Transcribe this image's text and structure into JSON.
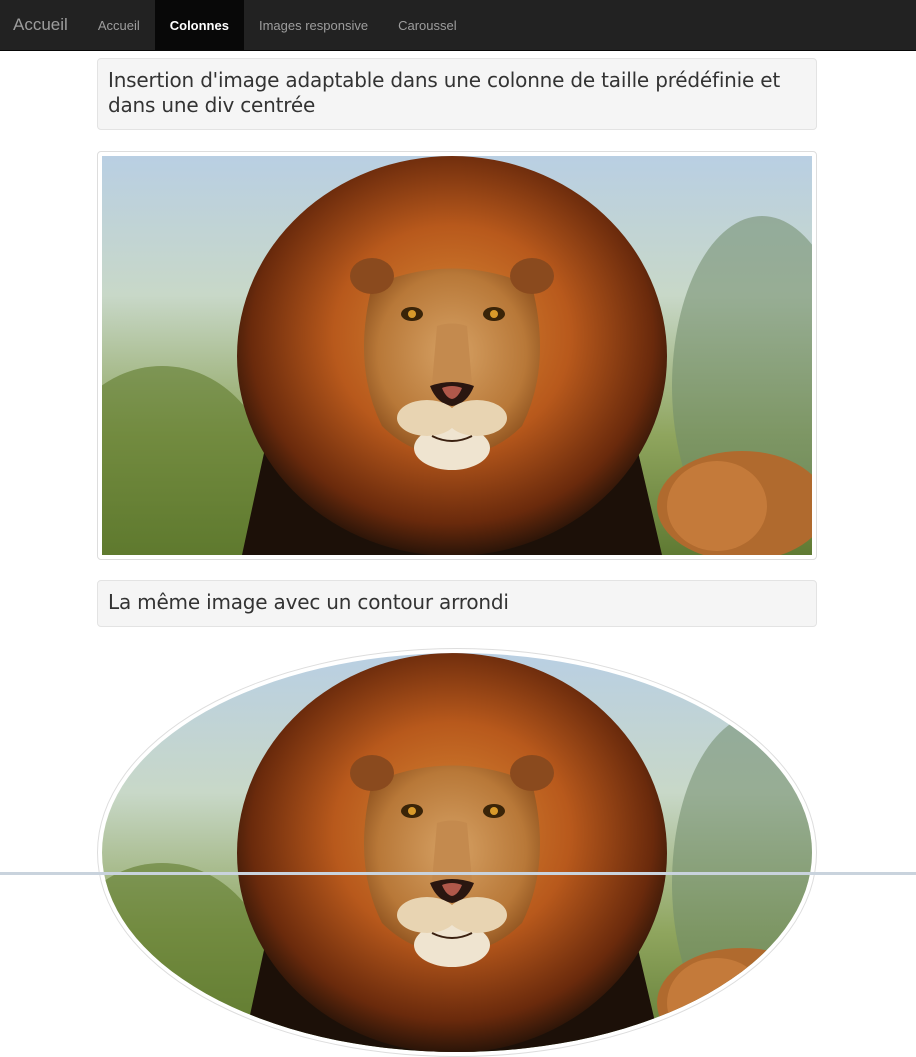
{
  "navbar": {
    "brand": "Accueil",
    "items": [
      {
        "label": "Accueil",
        "active": false
      },
      {
        "label": "Colonnes",
        "active": true
      },
      {
        "label": "Images responsive",
        "active": false
      },
      {
        "label": "Caroussel",
        "active": false
      }
    ],
    "colors": {
      "background": "#222222",
      "active_background": "#080808",
      "text": "#9d9d9d",
      "active_text": "#ffffff"
    }
  },
  "main": {
    "section1_title": "Insertion d'image adaptable dans une colonne de taille prédéfinie et dans une div centrée",
    "section2_title": "La même image avec un contour arrondi",
    "image_subject": "lion-portrait-photo"
  }
}
